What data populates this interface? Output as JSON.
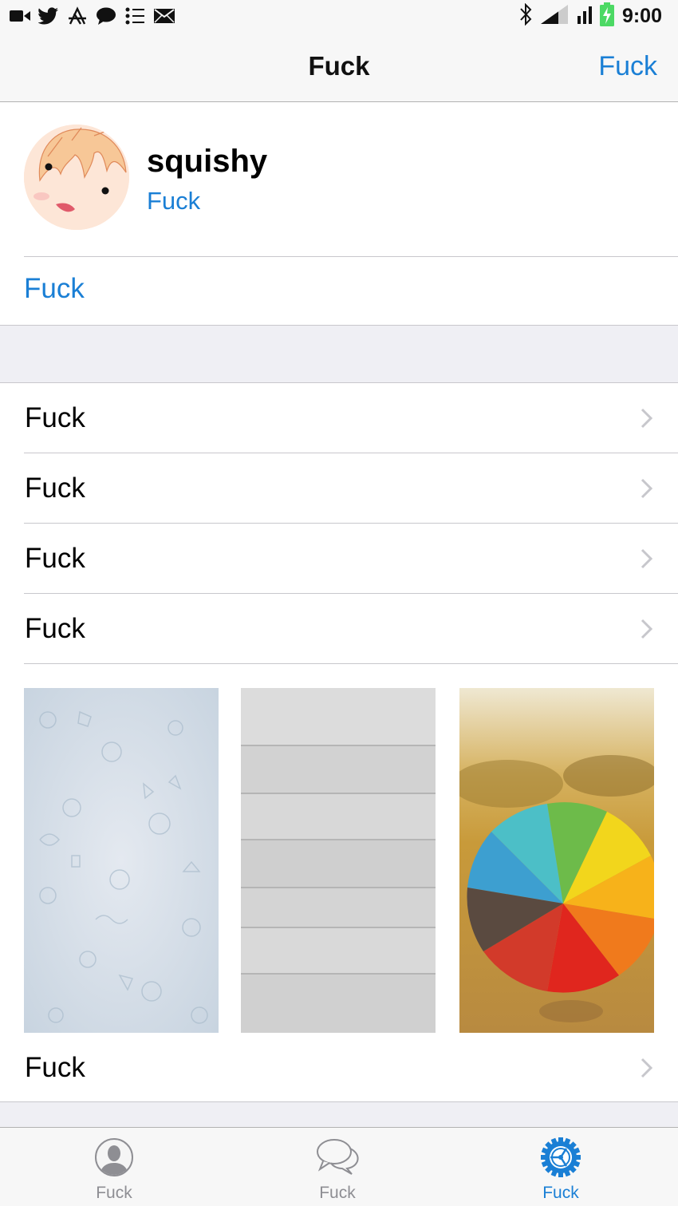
{
  "status_bar": {
    "time": "9:00",
    "left_icons": [
      "video-camera-icon",
      "twitter-bird-icon",
      "app-store-icon",
      "chat-bubble-icon",
      "list-icon",
      "mail-icon"
    ],
    "right_icons": [
      "bluetooth-icon",
      "cell-signal-icon",
      "wifi-bars-icon",
      "battery-charging-icon"
    ],
    "battery_color": "#4cd964"
  },
  "nav": {
    "title": "Fuck",
    "right_button": "Fuck"
  },
  "profile": {
    "name": "squishy",
    "status": "Fuck",
    "link": "Fuck"
  },
  "settings": {
    "rows": [
      {
        "label": "Fuck"
      },
      {
        "label": "Fuck"
      },
      {
        "label": "Fuck"
      },
      {
        "label": "Fuck"
      }
    ],
    "backgrounds": [
      "pattern-wallpaper",
      "wood-planks-wallpaper",
      "umbrella-photo-wallpaper"
    ],
    "bottom_row": {
      "label": "Fuck"
    }
  },
  "tab_bar": {
    "tabs": [
      {
        "label": "Fuck",
        "icon": "contacts-icon",
        "active": false
      },
      {
        "label": "Fuck",
        "icon": "chats-icon",
        "active": false
      },
      {
        "label": "Fuck",
        "icon": "settings-gear-icon",
        "active": true
      }
    ]
  },
  "colors": {
    "accent": "#1a7fd5",
    "separator": "#c8c7cc",
    "grouped_background": "#efeff4"
  }
}
